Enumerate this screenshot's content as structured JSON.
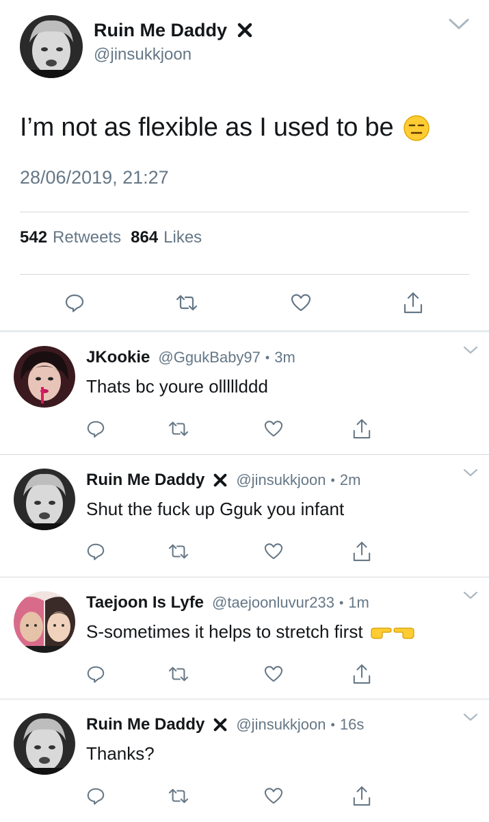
{
  "main_tweet": {
    "author_name": "Ruin Me Daddy",
    "author_handle": "@jinsukkjoon",
    "text": "I’m not as flexible as I used to be",
    "emoji_icon": "expressionless-face-emoji",
    "timestamp": "28/06/2019, 21:27",
    "retweets_count": "542",
    "retweets_label": "Retweets",
    "likes_count": "864",
    "likes_label": "Likes"
  },
  "replies": [
    {
      "author_name": "JKookie",
      "author_handle": "@GgukBaby97",
      "separator": "•",
      "time": "3m",
      "text": "Thats bc youre olllllddd",
      "has_x_mark": false
    },
    {
      "author_name": "Ruin Me Daddy",
      "author_handle": "@jinsukkjoon",
      "separator": "•",
      "time": "2m",
      "text": "Shut the fuck up Gguk you infant",
      "has_x_mark": true
    },
    {
      "author_name": "Taejoon Is Lyfe",
      "author_handle": "@taejoonluvur233",
      "separator": "•",
      "time": "1m",
      "text": "S-sometimes it helps to stretch first",
      "trailing_icons": [
        "hand-pointing-right-emoji",
        "hand-pointing-left-emoji"
      ],
      "has_x_mark": false
    },
    {
      "author_name": "Ruin Me Daddy",
      "author_handle": "@jinsukkjoon",
      "separator": "•",
      "time": "16s",
      "text": "Thanks?",
      "has_x_mark": true
    }
  ],
  "colors": {
    "text_primary": "#14171a",
    "text_secondary": "#657786",
    "divider": "#d6d9db",
    "icon": "#657786",
    "emoji_yellow": "#ffcc33"
  }
}
